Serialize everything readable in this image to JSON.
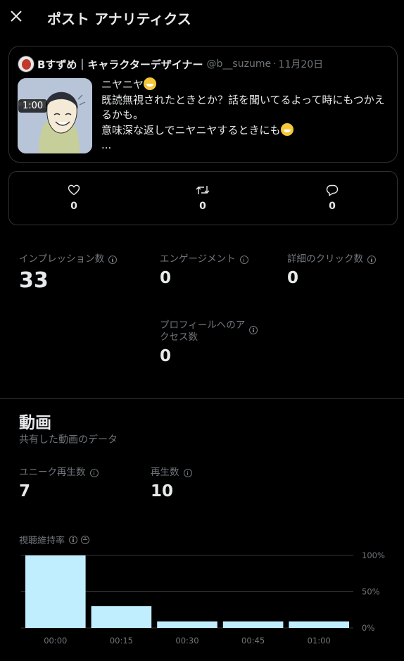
{
  "header": {
    "title": "ポスト アナリティクス",
    "close_icon": "close-icon"
  },
  "post": {
    "author_name": "Bすずめ｜キャラクターデザイナー",
    "handle": "@b__suzume",
    "separator": "·",
    "date": "11月20日",
    "video_duration": "1:00",
    "text_lines": [
      "ニヤニヤ",
      "既読無視されたときとか？話を聞いてるよって時にもつかえ",
      "るかも。",
      "意味深な返しでニヤニヤするときにも",
      "..."
    ]
  },
  "engagement": {
    "likes": {
      "icon": "heart-icon",
      "value": "0"
    },
    "reposts": {
      "icon": "repost-icon",
      "value": "0"
    },
    "replies": {
      "icon": "reply-icon",
      "value": "0"
    }
  },
  "stats": {
    "impressions": {
      "label": "インプレッション数",
      "value": "33"
    },
    "engagements": {
      "label": "エンゲージメント",
      "value": "0"
    },
    "detail_clicks": {
      "label": "詳細のクリック数",
      "value": "0"
    },
    "profile_visits": {
      "label_line1": "プロフィールへのア",
      "label_line2": "クセス数",
      "value": "0"
    }
  },
  "video": {
    "title": "動画",
    "subtitle": "共有した動画のデータ",
    "unique_views": {
      "label": "ユニーク再生数",
      "value": "7"
    },
    "views": {
      "label": "再生数",
      "value": "10"
    },
    "retention_label": "視聴維持率"
  },
  "chart_data": {
    "type": "bar",
    "categories": [
      "00:00",
      "00:15",
      "00:30",
      "00:45",
      "01:00"
    ],
    "values": [
      100,
      30,
      9,
      9,
      9
    ],
    "y_ticks": [
      "100%",
      "50%",
      "0%"
    ],
    "ylim": [
      0,
      100
    ],
    "bar_color": "#c0eeff",
    "grid": true
  }
}
